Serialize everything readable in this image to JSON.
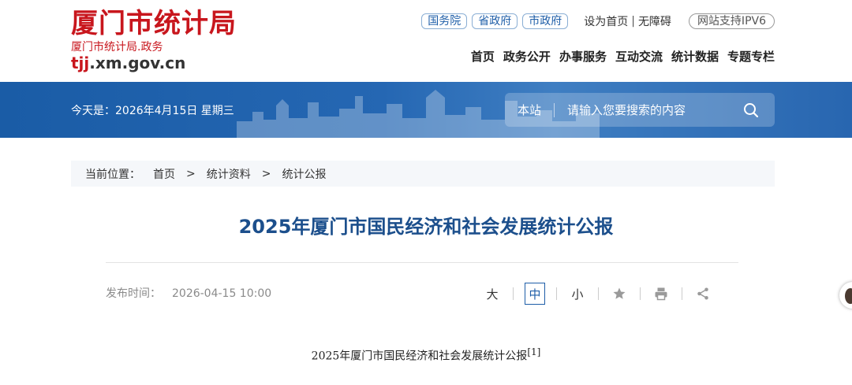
{
  "header": {
    "logo_title": "厦门市统计局",
    "logo_subtitle": "厦门市统计局.政务",
    "logo_domain_prefix": "tjj",
    "logo_domain_suffix": ".xm.gov.cn",
    "gov_links": [
      "国务院",
      "省政府",
      "市政府"
    ],
    "set_homepage": "设为首页",
    "separator": "|",
    "accessibility": "无障碍",
    "ipv6_badge": "网站支持IPV6",
    "nav": [
      "首页",
      "政务公开",
      "办事服务",
      "互动交流",
      "统计数据",
      "专题专栏"
    ]
  },
  "banner": {
    "today_text": "今天是：2026年4月15日 星期三",
    "search_scope": "本站",
    "search_placeholder": "请输入您要搜索的内容"
  },
  "breadcrumb": {
    "label": "当前位置：",
    "items": [
      "首页",
      "统计资料",
      "统计公报"
    ],
    "arrow": ">"
  },
  "article": {
    "title": "2025年厦门市国民经济和社会发展统计公报",
    "publish_label": "发布时间：",
    "publish_time": "2026-04-15 10:00",
    "font_large": "大",
    "font_medium": "中",
    "font_small": "小",
    "body_heading": "2025年厦门市国民经济和社会发展统计公报",
    "footnote_ref": "[1]"
  },
  "colors": {
    "brand_red": "#c8161d",
    "banner_blue": "#1a5ca6",
    "title_blue": "#1c4f8c"
  },
  "icons": [
    "search-icon",
    "star-icon",
    "print-icon",
    "share-icon"
  ]
}
